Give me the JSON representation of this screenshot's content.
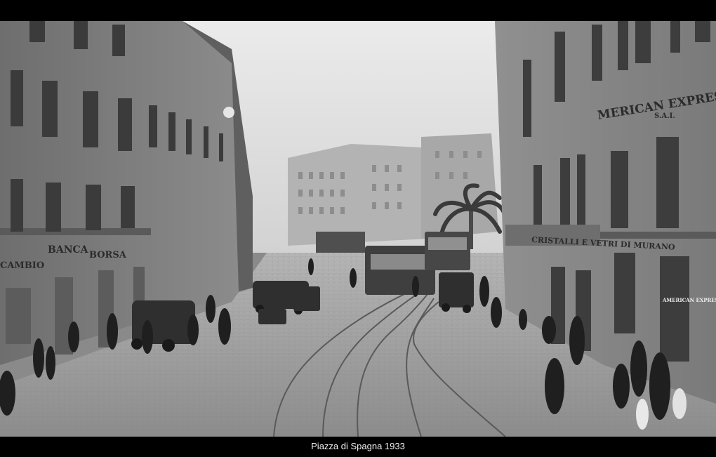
{
  "caption": "Piazza di Spagna 1933",
  "signs": {
    "american_express": "MERICAN EXPRESS",
    "american_express_sub": "S.A.I.",
    "banca": "BANCA",
    "borsa": "BORSA",
    "cambio": "CAMBIO",
    "vetri": "CRISTALLI E VETRI DI MURANO",
    "american_express_window": "AMERICAN EXPRESS Co"
  },
  "colors": {
    "sky": "#d9d9d9",
    "street": "#9c9c9c",
    "building_left": "#7a7a7a",
    "building_right": "#858585",
    "frame": "#000000"
  }
}
